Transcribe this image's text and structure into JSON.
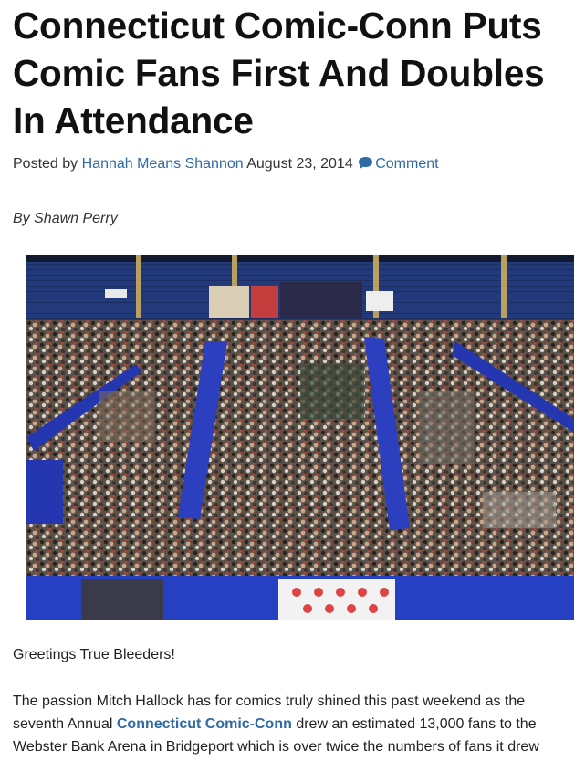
{
  "article": {
    "title": "Connecticut Comic-Conn Puts Comic Fans First And Doubles In Attendance",
    "posted_by_prefix": "Posted by",
    "author": "Hannah Means Shannon",
    "date": "August 23, 2014",
    "comment_label": "Comment",
    "comment_icon": "speech-bubble-icon",
    "byline": "By Shawn Perry",
    "image_alt": "Convention floor crowd",
    "greeting": "Greetings True Bleeders!",
    "paragraph2_part1": "The passion Mitch Hallock has for comics truly shined this past weekend as the seventh Annual ",
    "paragraph2_link": "Connecticut Comic-Conn",
    "paragraph2_part2": " drew an estimated 13,000 fans to the Webster Bank Arena in Bridgeport which is over twice the numbers of fans it drew"
  },
  "colors": {
    "link": "#2f6aa5",
    "title": "#111111"
  }
}
